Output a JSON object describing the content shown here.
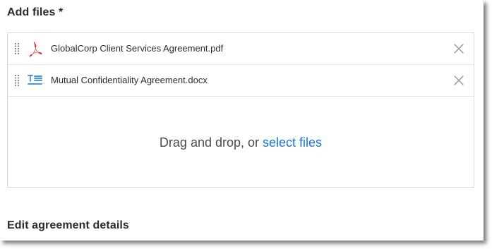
{
  "add_files": {
    "title": "Add files *",
    "files": [
      {
        "name": "GlobalCorp Client Services Agreement.pdf",
        "type_icon": "pdf-icon"
      },
      {
        "name": "Mutual Confidentiality Agreement.docx",
        "type_icon": "text-document-icon"
      }
    ],
    "remove_icon": "close-icon",
    "drop_zone": {
      "prompt": "Drag and drop, or ",
      "link_label": "select files"
    }
  },
  "edit_details": {
    "title": "Edit agreement details"
  },
  "colors": {
    "link": "#1473e6",
    "pdf_red": "#e0251b",
    "doc_blue": "#1473e6",
    "border": "#dcdcdc"
  }
}
